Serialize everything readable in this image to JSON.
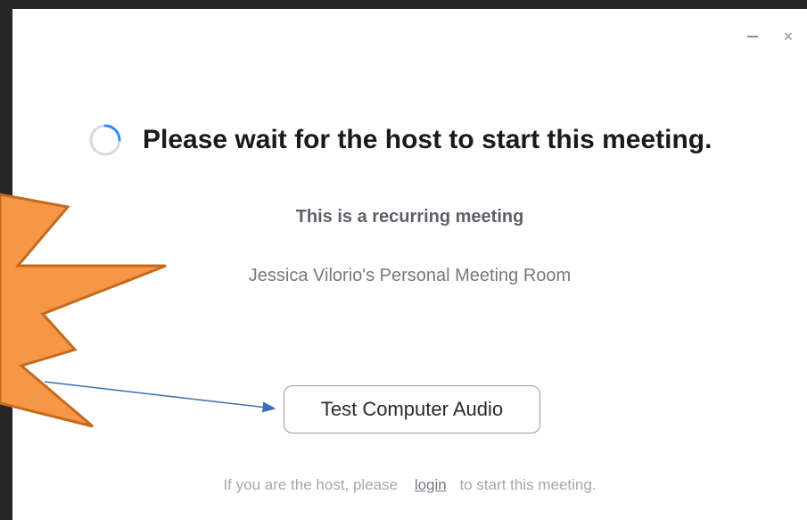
{
  "window": {
    "minimize_label": "–",
    "close_label": "×"
  },
  "main": {
    "headline": "Please wait for the host to start this meeting.",
    "subtitle": "This is a recurring meeting",
    "room_name": "Jessica Vilorio's Personal Meeting Room",
    "test_audio_label": "Test Computer Audio"
  },
  "footer": {
    "prefix": "If you are the host, please",
    "login_link": "login",
    "suffix": "to start this meeting."
  },
  "colors": {
    "starburst": "#f79646",
    "starburst_outline": "#c56a1c",
    "arrow": "#3b6db5",
    "spinner": "#2d8cff"
  },
  "icons": {
    "spinner": "loading-spinner-icon",
    "minimize": "minimize-icon",
    "close": "close-icon"
  }
}
